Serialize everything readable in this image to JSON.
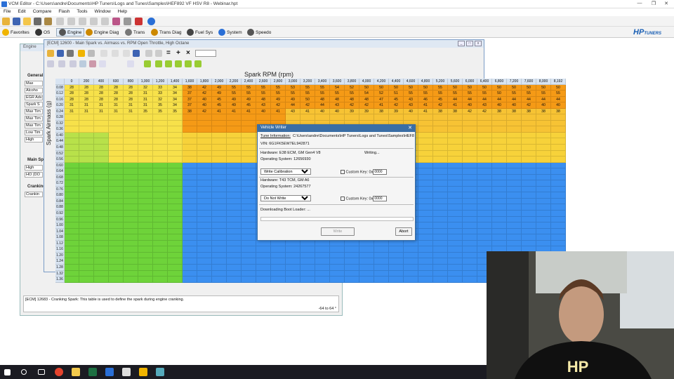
{
  "window": {
    "title": "VCM Editor - C:\\Users\\andre\\Documents\\HP Tuners\\Logs and Tunes\\Samples\\HEF892 VF HSV R8 - Webinar.hpt",
    "controls": [
      "—",
      "❐",
      "✕"
    ]
  },
  "menu": [
    "File",
    "Edit",
    "Compare",
    "Flash",
    "Tools",
    "Window",
    "Help"
  ],
  "toolbar2": [
    {
      "label": "Favorites",
      "color": "#f0b400"
    },
    {
      "label": "OS",
      "color": "#333"
    },
    {
      "label": "Engine",
      "color": "#555"
    },
    {
      "label": "Engine Diag",
      "color": "#c80"
    },
    {
      "label": "Trans",
      "color": "#777"
    },
    {
      "label": "Trans Diag",
      "color": "#c80"
    },
    {
      "label": "Fuel Sys",
      "color": "#444"
    },
    {
      "label": "System",
      "color": "#2a6fd6"
    },
    {
      "label": "Speedo",
      "color": "#555"
    }
  ],
  "logo": {
    "text": "HP",
    "sub": "TUNERS"
  },
  "back_window": {
    "title": "Engine",
    "sections": [
      "General",
      "Main Sp",
      "Cranking"
    ],
    "general_items": [
      "Max",
      "Alcoho",
      "EGR Adv",
      "Spark S",
      "Max Tim",
      "Max Tim",
      "Max Tim",
      "Low Tim",
      "High"
    ],
    "main_items": [
      "High",
      "HO (DO"
    ],
    "crank_items": [
      "Crankin"
    ],
    "status": "[ECM] 12683 - Cranking Spark: This table is used to define the spark during engine cranking.",
    "status_value": "-64 to 64 °"
  },
  "table_window": {
    "title": "[ECM] 12600 - Main Spark vs. Airmass vs. RPM Open Throttle, High Octane",
    "x_axis": "Spark RPM (rpm)",
    "y_axis": "Spark Airmass (g)",
    "cols": [
      "0",
      "200",
      "400",
      "600",
      "800",
      "1,000",
      "1,200",
      "1,400",
      "1,600",
      "1,800",
      "2,000",
      "2,200",
      "2,400",
      "2,600",
      "2,800",
      "3,000",
      "3,200",
      "3,400",
      "3,600",
      "3,800",
      "4,000",
      "4,200",
      "4,400",
      "4,600",
      "4,800",
      "5,200",
      "5,600",
      "6,000",
      "6,400",
      "6,800",
      "7,200",
      "7,600",
      "8,000",
      "8,192"
    ],
    "rows": [
      "0.08",
      "0.12",
      "0.16",
      "0.20",
      "0.24",
      "0.28",
      "0.32",
      "0.36",
      "0.40",
      "0.44",
      "0.48",
      "0.52",
      "0.56",
      "0.60",
      "0.64",
      "0.68",
      "0.72",
      "0.76",
      "0.80",
      "0.84",
      "0.88",
      "0.92",
      "0.96",
      "1.00",
      "1.04",
      "1.08",
      "1.12",
      "1.16",
      "1.20",
      "1.24",
      "1.28",
      "1.32",
      "1.36"
    ],
    "first_rows": [
      [
        "28",
        "28",
        "28",
        "28",
        "28",
        "32",
        "33",
        "34",
        "38",
        "42",
        "49",
        "55",
        "55",
        "55",
        "55",
        "53",
        "55",
        "55",
        "54",
        "52",
        "50",
        "50",
        "50",
        "50",
        "50",
        "55",
        "50",
        "50",
        "50",
        "50",
        "50",
        "50",
        "50",
        "50"
      ],
      [
        "28",
        "28",
        "28",
        "28",
        "28",
        "31",
        "33",
        "34",
        "37",
        "42",
        "49",
        "55",
        "55",
        "55",
        "55",
        "55",
        "55",
        "55",
        "55",
        "55",
        "54",
        "52",
        "51",
        "55",
        "55",
        "55",
        "55",
        "55",
        "55",
        "50",
        "55",
        "55",
        "55",
        "55"
      ],
      [
        "28",
        "28",
        "28",
        "28",
        "28",
        "31",
        "32",
        "34",
        "37",
        "40",
        "45",
        "49",
        "49",
        "48",
        "49",
        "49",
        "50",
        "48",
        "48",
        "48",
        "48",
        "47",
        "45",
        "43",
        "46",
        "45",
        "44",
        "44",
        "44",
        "44",
        "44",
        "44",
        "44",
        "44"
      ],
      [
        "31",
        "31",
        "31",
        "31",
        "31",
        "31",
        "35",
        "34",
        "37",
        "40",
        "45",
        "49",
        "45",
        "43",
        "42",
        "44",
        "42",
        "44",
        "43",
        "42",
        "42",
        "41",
        "42",
        "43",
        "41",
        "42",
        "41",
        "40",
        "43",
        "40",
        "40",
        "42",
        "40",
        "40"
      ],
      [
        "31",
        "31",
        "31",
        "31",
        "31",
        "35",
        "35",
        "35",
        "38",
        "42",
        "41",
        "41",
        "41",
        "40",
        "41",
        "43",
        "41",
        "40",
        "40",
        "39",
        "39",
        "38",
        "39",
        "40",
        "41",
        "38",
        "38",
        "42",
        "42",
        "38",
        "38",
        "38",
        "38",
        "38"
      ]
    ]
  },
  "dialog": {
    "title": "Vehicle Writer",
    "tune_info_label": "Tune Information:",
    "tune_info_path": "C:\\Users\\andre\\Documents\\HP Tuners\\Logs and Tunes\\Samples\\HEF8",
    "vin": "VIN: 6G1FK5EW7EL942871",
    "hw1": "Hardware: E38 ECM, GM Gen4 V8",
    "writing": "Writing...",
    "os1": "Operating System: 12656930",
    "sel1": "Write Calibration",
    "custom_key": "Custom Key: 0x",
    "key1": "0000",
    "hw2": "Hardware: T43 TCM, GM A6",
    "os2": "Operating System: 24267577",
    "sel2": "Do Not Write",
    "key2": "0000",
    "progress_label": "Downloading Boot Loader: ...",
    "write": "Write",
    "abort": "Abort"
  },
  "webcam": {
    "shirt_text": "HP"
  }
}
